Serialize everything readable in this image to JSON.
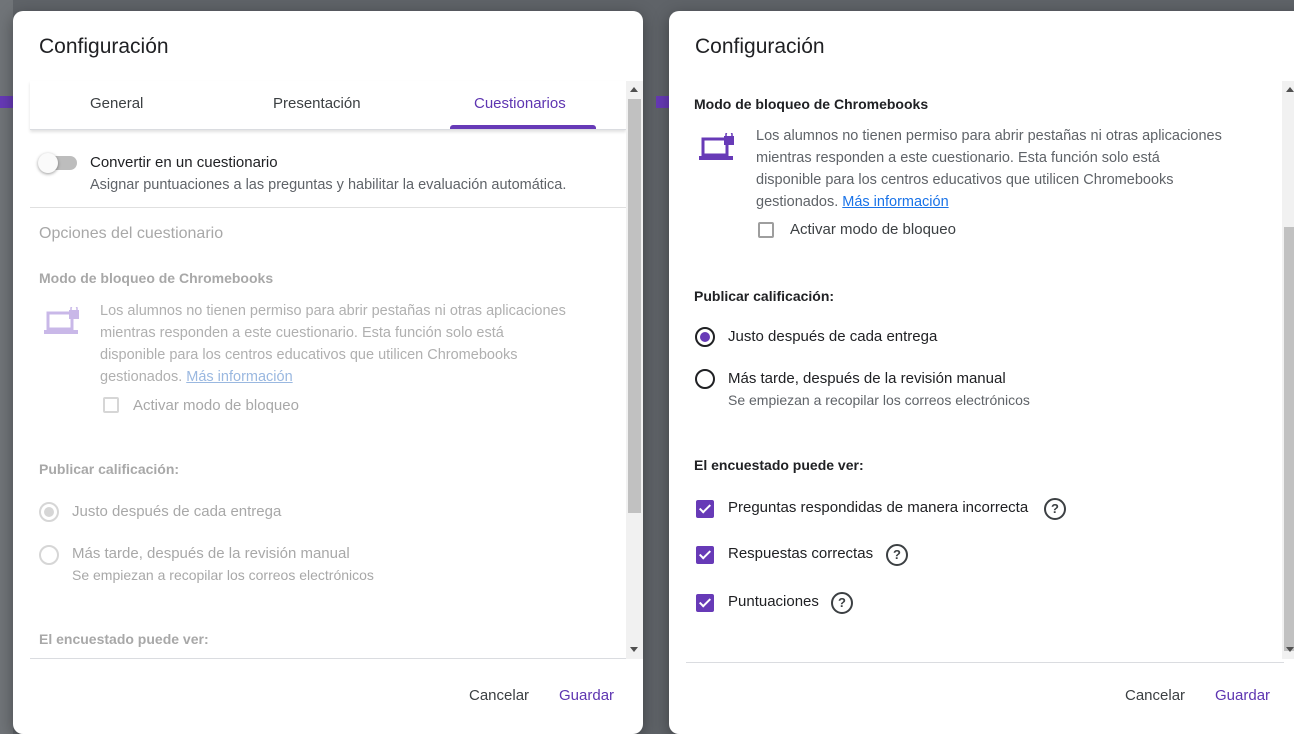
{
  "left_dialog": {
    "title": "Configuración",
    "tabs": [
      {
        "label": "General"
      },
      {
        "label": "Presentación"
      },
      {
        "label": "Cuestionarios"
      }
    ],
    "quiz_toggle": {
      "label": "Convertir en un cuestionario",
      "description": "Asignar puntuaciones a las preguntas y habilitar la evaluación automática.",
      "enabled": false
    },
    "quiz_options_heading": "Opciones del cuestionario",
    "lock_mode": {
      "heading": "Modo de bloqueo de Chromebooks",
      "line1": "Los alumnos no tienen permiso para abrir pestañas ni otras aplicaciones",
      "line2": "mientras responden a este cuestionario. Esta función solo está",
      "line3": "disponible para los centros educativos que utilicen Chromebooks",
      "line4": "gestionados.",
      "link": "Más información",
      "checkbox_label": "Activar modo de bloqueo"
    },
    "publish": {
      "heading": "Publicar calificación:",
      "option1": "Justo después de cada entrega",
      "option2": "Más tarde, después de la revisión manual",
      "option2_sub": "Se empiezan a recopilar los correos electrónicos"
    },
    "respondent_heading": "El encuestado puede ver:",
    "cancel": "Cancelar",
    "save": "Guardar"
  },
  "right_dialog": {
    "title": "Configuración",
    "lock_mode": {
      "heading": "Modo de bloqueo de Chromebooks",
      "line1": "Los alumnos no tienen permiso para abrir pestañas ni otras aplicaciones",
      "line2": "mientras responden a este cuestionario. Esta función solo está",
      "line3": "disponible para los centros educativos que utilicen Chromebooks",
      "line4": "gestionados.",
      "link": "Más información",
      "checkbox_label": "Activar modo de bloqueo"
    },
    "publish": {
      "heading": "Publicar calificación:",
      "option1": "Justo después de cada entrega",
      "option1_selected": true,
      "option2": "Más tarde, después de la revisión manual",
      "option2_sub": "Se empiezan a recopilar los correos electrónicos"
    },
    "respondent": {
      "heading": "El encuestado puede ver:",
      "items": [
        {
          "label": "Preguntas respondidas de manera incorrecta",
          "checked": true
        },
        {
          "label": "Respuestas correctas",
          "checked": true
        },
        {
          "label": "Puntuaciones",
          "checked": true
        }
      ]
    },
    "cancel": "Cancelar",
    "save": "Guardar"
  },
  "colors": {
    "accent": "#673ab7",
    "link": "#1a73e8",
    "overlay": "#5f6368"
  }
}
